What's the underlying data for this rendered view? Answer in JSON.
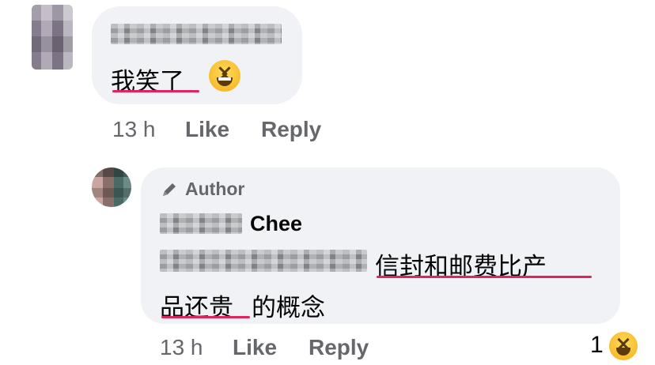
{
  "comment1": {
    "author_name_redacted": "",
    "text": "我笑了",
    "emoji_icon": "laughing-emoji",
    "time": "13 h",
    "like_label": "Like",
    "reply_label": "Reply"
  },
  "reply": {
    "badge_icon": "pencil-icon",
    "badge_label": "Author",
    "author_name_visible": "Chee",
    "text_line1": "信封和邮费比产",
    "text_line2_a": "品还贵",
    "text_line2_b": "的概念",
    "time": "13 h",
    "like_label": "Like",
    "reply_label": "Reply",
    "reaction_count": "1",
    "reaction_icon": "laughing-emoji"
  },
  "colors": {
    "bubble": "#f0f2f5",
    "meta_text": "#65676b",
    "underline": "#e0245e"
  }
}
